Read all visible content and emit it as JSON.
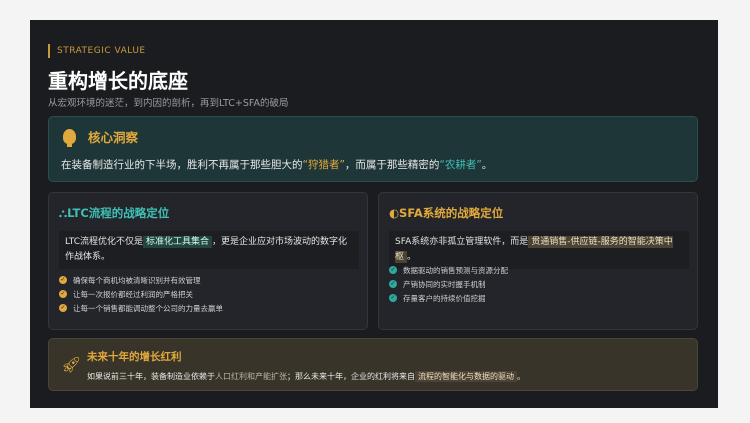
{
  "eyebrow": "STRATEGIC VALUE",
  "title": "重构增长的底座",
  "subtitle": "从宏观环境的迷茫，到内因的剖析，再到LTC+SFA的破局",
  "insight": {
    "title": "核心洞察",
    "text_a": "在装备制造行业的下半场，胜利不再属于那些胆大的",
    "hl1": "“狩猎者”",
    "text_b": "，而属于那些精密的",
    "hl2": "“农耕者”",
    "text_c": "。"
  },
  "ltc": {
    "title": "LTC流程的战略定位",
    "quote_a": "LTC流程优化不仅是",
    "quote_hl": "标准化工具集合",
    "quote_b": "，更是企业应对市场波动的数字化作战体系。",
    "items": [
      "确保每个商机均被清晰识别并有效管理",
      "让每一次报价都经过利润的严格把关",
      "让每一个销售都能调动整个公司的力量去赢单"
    ]
  },
  "sfa": {
    "title": "SFA系统的战略定位",
    "quote_a": "SFA系统亦非孤立管理软件，而是",
    "quote_hl": "贯通销售-供应链-服务的智能决策中枢",
    "quote_b": "。",
    "items": [
      "数据驱动的销售预测与资源分配",
      "产销协同的实时握手机制",
      "存量客户的持续价值挖掘"
    ]
  },
  "bonus": {
    "title": "未来十年的增长红利",
    "text_a": "如果说前三十年，装备制造业依赖于",
    "muted": "人口红利和产能扩张",
    "text_b": "；那么未来十年，企业的红利将来自",
    "hl": "流程的智能化与数据的驱动",
    "text_c": "。"
  }
}
